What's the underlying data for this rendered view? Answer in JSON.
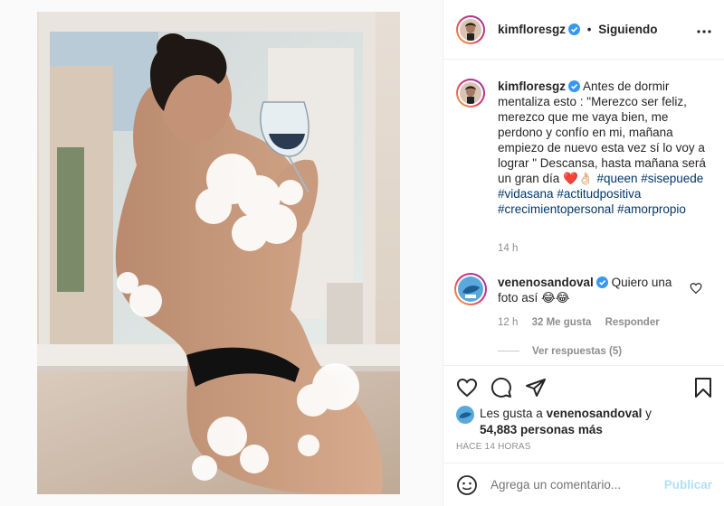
{
  "post": {
    "username": "kimfloresgz",
    "separator": "•",
    "follow_label": "Siguiendo",
    "more_label": "•••",
    "caption_text": "Antes de dormir mentaliza esto : \"Merezco ser feliz, merezco que me vaya bien, me perdono y confío en mi, mañana empiezo de nuevo esta vez sí lo voy a lograr \" Descansa, hasta mañana será un gran día ❤️👌🏻",
    "hashtags_1": "#queen #sisepuede #vidasana",
    "hashtags_2": "#actitudpositiva",
    "hashtags_3": "#crecimientopersonal #amorpropio",
    "caption_time": "14 h"
  },
  "comment": {
    "username": "venenosandoval",
    "text": "Quiero una foto así 😂😂",
    "time": "12 h",
    "likes": "32 Me gusta",
    "reply_label": "Responder",
    "view_replies": "Ver respuestas (5)"
  },
  "likes": {
    "prefix": "Les gusta a",
    "user": "venenosandoval",
    "conj": "y",
    "others": "54,883 personas más"
  },
  "timestamp": "HACE 14 HORAS",
  "add_comment": {
    "placeholder": "Agrega un comentario...",
    "publish_label": "Publicar"
  },
  "colors": {
    "verified": "#3897f0",
    "link": "#00376b",
    "muted": "#8e8e8e",
    "publish_disabled": "#b2dffc"
  },
  "icons": {
    "like": "heart-icon",
    "comment": "comment-bubble-icon",
    "share": "paper-plane-icon",
    "save": "bookmark-icon",
    "emoji": "smiley-icon",
    "more": "ellipsis-icon",
    "verified": "verified-badge-icon"
  }
}
